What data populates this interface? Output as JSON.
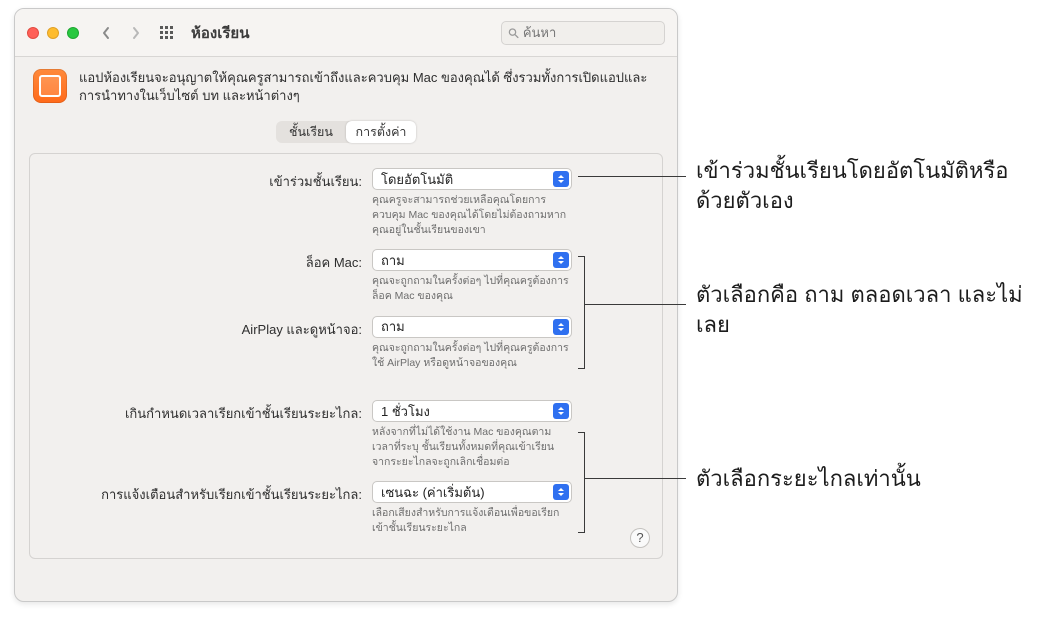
{
  "window": {
    "title": "ห้องเรียน",
    "search_placeholder": "ค้นหา"
  },
  "intro": "แอปห้องเรียนจะอนุญาตให้คุณครูสามารถเข้าถึงและควบคุม Mac ของคุณได้ ซึ่งรวมทั้งการเปิดแอปและการนำทางในเว็บไซต์ บท และหน้าต่างๆ",
  "tabs": {
    "class": "ชั้นเรียน",
    "settings": "การตั้งค่า"
  },
  "rows": {
    "join": {
      "label": "เข้าร่วมชั้นเรียน:",
      "value": "โดยอัตโนมัติ",
      "hint": "คุณครูจะสามารถช่วยเหลือคุณโดยการควบคุม Mac ของคุณได้โดยไม่ต้องถามหากคุณอยู่ในชั้นเรียนของเขา"
    },
    "lock": {
      "label": "ล็อค Mac:",
      "value": "ถาม",
      "hint": "คุณจะถูกถามในครั้งต่อๆ ไปที่คุณครูต้องการล็อค Mac ของคุณ"
    },
    "airplay": {
      "label": "AirPlay และดูหน้าจอ:",
      "value": "ถาม",
      "hint": "คุณจะถูกถามในครั้งต่อๆ ไปที่คุณครูต้องการใช้ AirPlay หรือดูหน้าจอของคุณ"
    },
    "timeout": {
      "label": "เกินกำหนดเวลาเรียกเข้าชั้นเรียนระยะไกล:",
      "value": "1 ชั่วโมง",
      "hint": "หลังจากที่ไม่ได้ใช้งาน Mac ของคุณตามเวลาที่ระบุ ชั้นเรียนทั้งหมดที่คุณเข้าเรียนจากระยะไกลจะถูกเลิกเชื่อมต่อ"
    },
    "notify": {
      "label": "การแจ้งเตือนสำหรับเรียกเข้าชั้นเรียนระยะไกล:",
      "value": "เซนฉะ (ค่าเริ่มต้น)",
      "hint": "เลือกเสียงสำหรับการแจ้งเตือนเพื่อขอเรียกเข้าชั้นเรียนระยะไกล"
    }
  },
  "annotations": {
    "a1": "เข้าร่วมชั้นเรียนโดยอัตโนมัติหรือด้วยตัวเอง",
    "a2": "ตัวเลือกคือ ถาม ตลอดเวลา และไม่เลย",
    "a3": "ตัวเลือกระยะไกลเท่านั้น"
  },
  "help": "?"
}
